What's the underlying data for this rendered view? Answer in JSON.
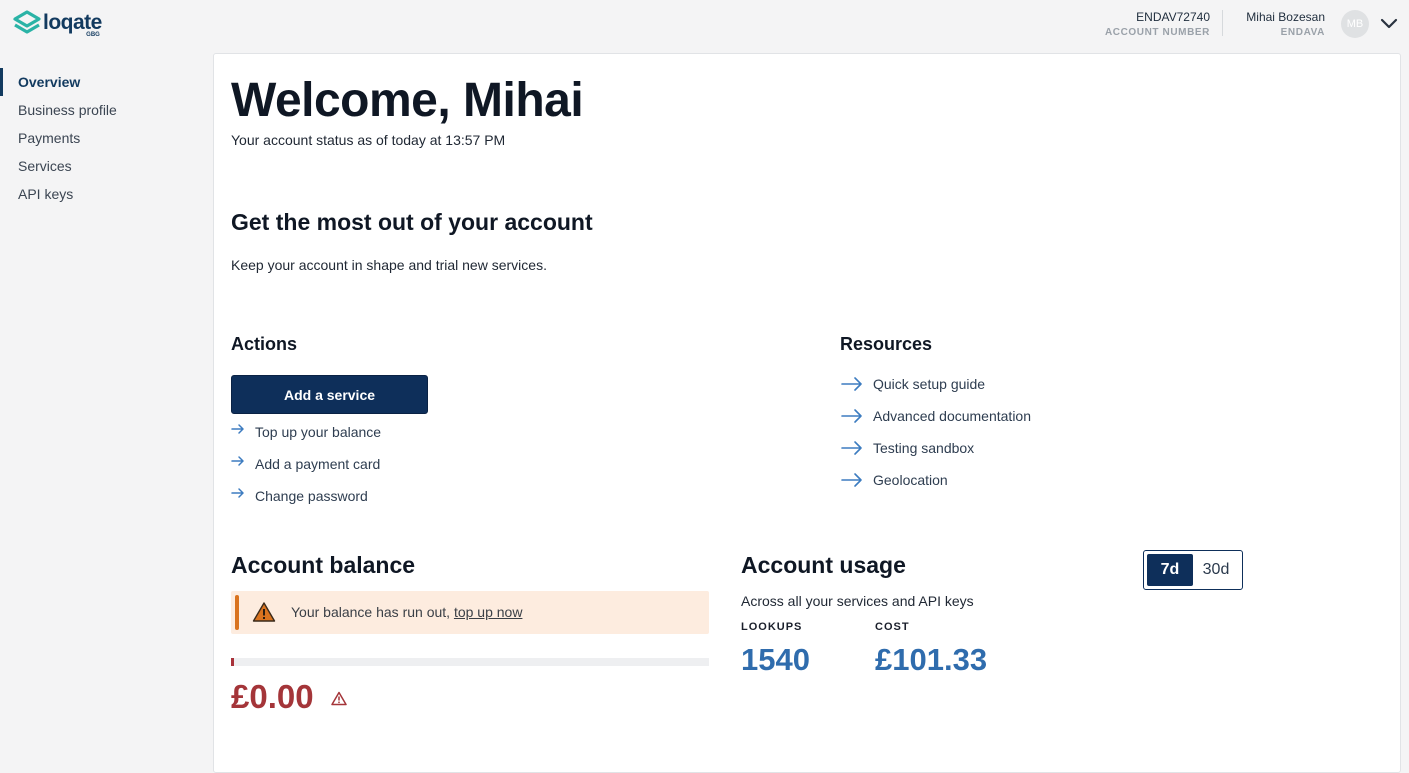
{
  "brand": {
    "name": "loqate",
    "sub": "GBG",
    "color": "#2ab3a6",
    "dark": "#123a5f"
  },
  "header": {
    "account_number": "ENDAV72740",
    "account_number_label": "ACCOUNT NUMBER",
    "user_name": "Mihai Bozesan",
    "user_org": "ENDAVA",
    "avatar_initials": "MB"
  },
  "sidebar": {
    "items": [
      {
        "label": "Overview",
        "active": true
      },
      {
        "label": "Business profile"
      },
      {
        "label": "Payments"
      },
      {
        "label": "Services"
      },
      {
        "label": "API keys"
      }
    ]
  },
  "main": {
    "welcome": "Welcome, Mihai",
    "status": "Your account status as of today at 13:57 PM",
    "section_title": "Get the most out of your account",
    "section_sub": "Keep your account in shape and trial new services.",
    "actions": {
      "title": "Actions",
      "primary_button": "Add a service",
      "links": [
        "Top up your balance",
        "Add a payment card",
        "Change password"
      ]
    },
    "resources": {
      "title": "Resources",
      "links": [
        "Quick setup guide",
        "Advanced documentation",
        "Testing sandbox",
        "Geolocation"
      ]
    },
    "balance": {
      "title": "Account balance",
      "alert_text": "Your balance has run out, ",
      "alert_link": "top up now",
      "amount": "£0.00",
      "progress_fraction": 0.005
    },
    "usage": {
      "title": "Account usage",
      "sub": "Across all your services and API keys",
      "toggle": [
        "7d",
        "30d"
      ],
      "toggle_selected": "7d",
      "lookups_label": "LOOKUPS",
      "lookups_value": "1540",
      "cost_label": "COST",
      "cost_value": "£101.33"
    }
  },
  "colors": {
    "primary": "#0e2f5a",
    "link_arrow": "#3d7cc0",
    "danger": "#a43539",
    "warning": "#d9731f",
    "stat": "#2f6cad"
  }
}
